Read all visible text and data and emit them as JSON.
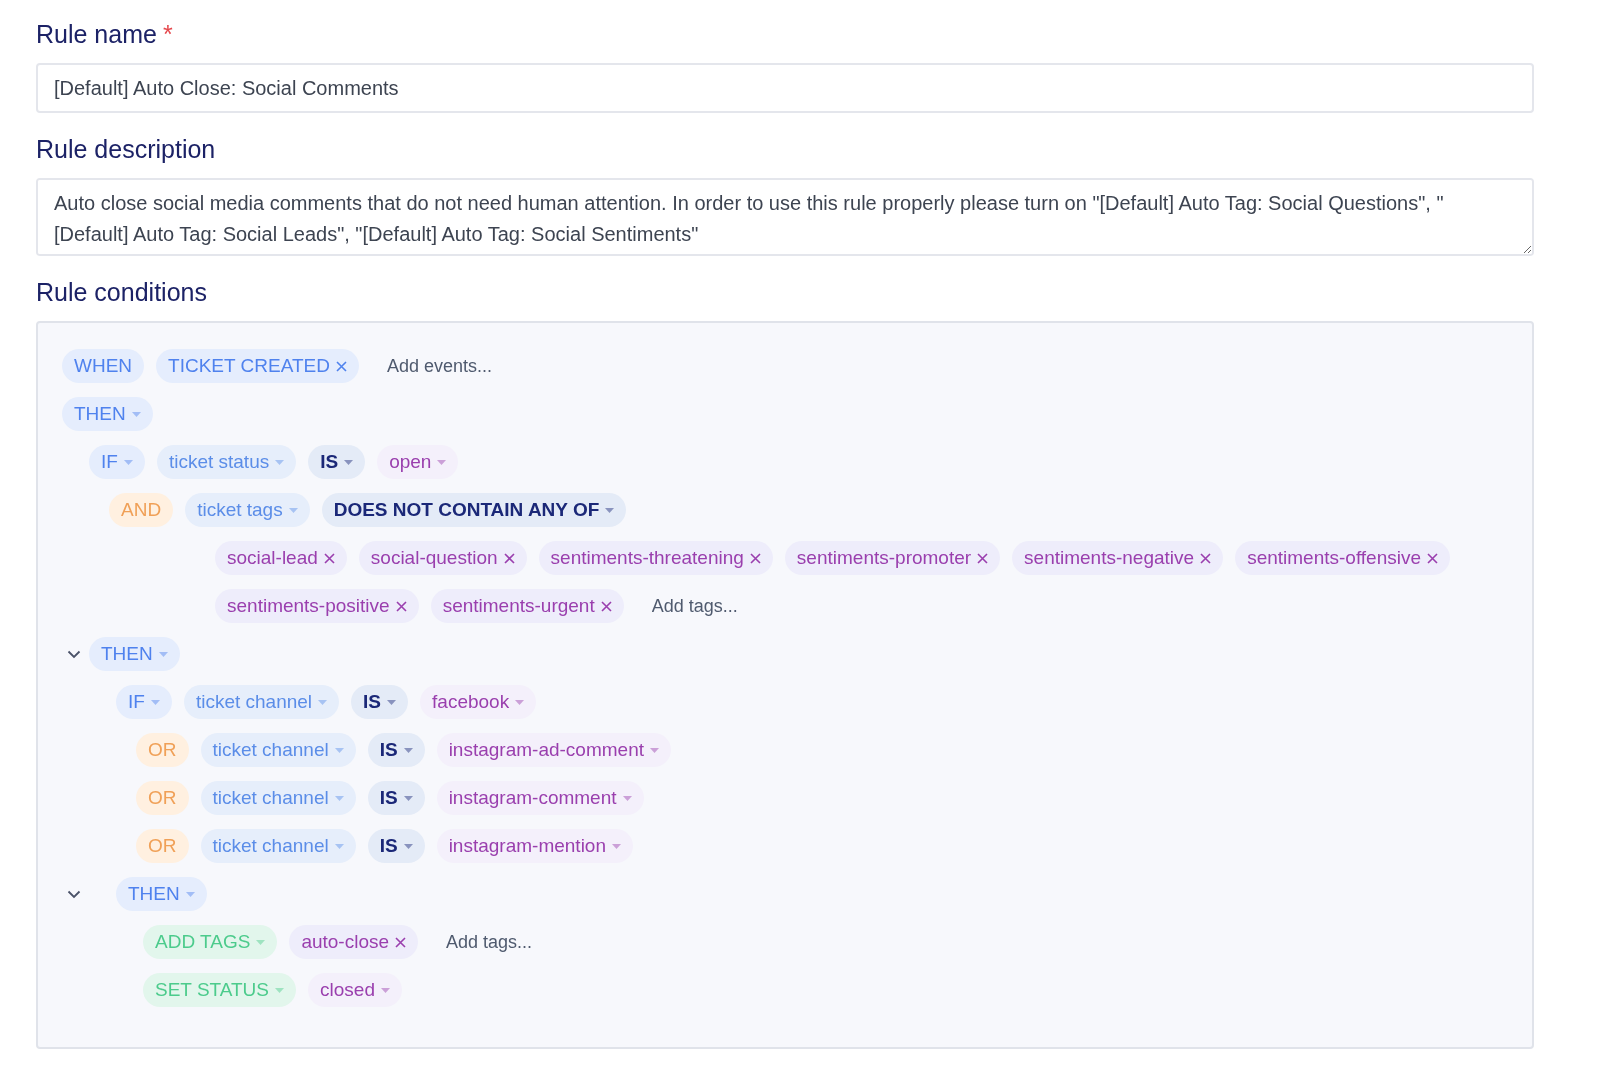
{
  "rule_name": {
    "label": "Rule name",
    "required_mark": "*",
    "value": "[Default] Auto Close: Social Comments"
  },
  "rule_description": {
    "label": "Rule description",
    "value": "Auto close social media comments that do not need human attention. In order to use this rule properly please turn on \"[Default] Auto Tag: Social Questions\", \"[Default] Auto Tag: Social Leads\", \"[Default] Auto Tag: Social Sentiments\""
  },
  "rule_conditions": {
    "label": "Rule conditions",
    "when": [
      {
        "kind": "keyword",
        "text": "WHEN",
        "dropdown": false
      },
      {
        "kind": "event",
        "text": "TICKET CREATED",
        "removable": true
      },
      {
        "kind": "input",
        "placeholder": "Add events..."
      }
    ],
    "tree": {
      "kind": "block",
      "head": [
        {
          "kind": "keyword",
          "text": "THEN",
          "dropdown": true
        }
      ],
      "children": [
        {
          "kind": "row",
          "items": [
            {
              "kind": "keyword",
              "text": "IF",
              "dropdown": true
            },
            {
              "kind": "field",
              "text": "ticket status",
              "dropdown": true
            },
            {
              "kind": "operator",
              "text": "IS",
              "dropdown": true
            },
            {
              "kind": "value",
              "text": "open",
              "dropdown": true
            }
          ]
        },
        {
          "kind": "row",
          "items": [
            {
              "kind": "connector",
              "text": "AND",
              "dropdown": false
            },
            {
              "kind": "field",
              "text": "ticket tags",
              "dropdown": true
            },
            {
              "kind": "operator",
              "text": "DOES NOT CONTAIN ANY OF",
              "dropdown": true
            }
          ],
          "tags": [
            {
              "kind": "tag",
              "text": "social-lead",
              "removable": true
            },
            {
              "kind": "tag",
              "text": "social-question",
              "removable": true
            },
            {
              "kind": "tag",
              "text": "sentiments-threatening",
              "removable": true
            },
            {
              "kind": "tag",
              "text": "sentiments-promoter",
              "removable": true
            },
            {
              "kind": "tag",
              "text": "sentiments-negative",
              "removable": true
            },
            {
              "kind": "tag",
              "text": "sentiments-offensive",
              "removable": true
            },
            {
              "kind": "tag",
              "text": "sentiments-positive",
              "removable": true
            },
            {
              "kind": "tag",
              "text": "sentiments-urgent",
              "removable": true
            },
            {
              "kind": "input",
              "placeholder": "Add tags..."
            }
          ]
        },
        {
          "kind": "block",
          "expanded": true,
          "head": [
            {
              "kind": "keyword",
              "text": "THEN",
              "dropdown": true
            }
          ],
          "children": [
            {
              "kind": "row",
              "items": [
                {
                  "kind": "keyword",
                  "text": "IF",
                  "dropdown": true
                },
                {
                  "kind": "field",
                  "text": "ticket channel",
                  "dropdown": true
                },
                {
                  "kind": "operator",
                  "text": "IS",
                  "dropdown": true
                },
                {
                  "kind": "value",
                  "text": "facebook",
                  "dropdown": true
                }
              ]
            },
            {
              "kind": "row",
              "items": [
                {
                  "kind": "connector",
                  "text": "OR",
                  "dropdown": false
                },
                {
                  "kind": "field",
                  "text": "ticket channel",
                  "dropdown": true
                },
                {
                  "kind": "operator",
                  "text": "IS",
                  "dropdown": true
                },
                {
                  "kind": "value",
                  "text": "instagram-ad-comment",
                  "dropdown": true
                }
              ]
            },
            {
              "kind": "row",
              "items": [
                {
                  "kind": "connector",
                  "text": "OR",
                  "dropdown": false
                },
                {
                  "kind": "field",
                  "text": "ticket channel",
                  "dropdown": true
                },
                {
                  "kind": "operator",
                  "text": "IS",
                  "dropdown": true
                },
                {
                  "kind": "value",
                  "text": "instagram-comment",
                  "dropdown": true
                }
              ]
            },
            {
              "kind": "row",
              "items": [
                {
                  "kind": "connector",
                  "text": "OR",
                  "dropdown": false
                },
                {
                  "kind": "field",
                  "text": "ticket channel",
                  "dropdown": true
                },
                {
                  "kind": "operator",
                  "text": "IS",
                  "dropdown": true
                },
                {
                  "kind": "value",
                  "text": "instagram-mention",
                  "dropdown": true
                }
              ]
            },
            {
              "kind": "block",
              "expanded": true,
              "head": [
                {
                  "kind": "keyword",
                  "text": "THEN",
                  "dropdown": true
                }
              ],
              "children": [
                {
                  "kind": "row",
                  "items": [
                    {
                      "kind": "action",
                      "text": "ADD TAGS",
                      "dropdown": true
                    },
                    {
                      "kind": "tag",
                      "text": "auto-close",
                      "removable": true
                    },
                    {
                      "kind": "input",
                      "placeholder": "Add tags..."
                    }
                  ]
                },
                {
                  "kind": "row",
                  "items": [
                    {
                      "kind": "action",
                      "text": "SET STATUS",
                      "dropdown": true
                    },
                    {
                      "kind": "value",
                      "text": "closed",
                      "dropdown": true
                    }
                  ]
                }
              ]
            }
          ]
        }
      ]
    }
  }
}
